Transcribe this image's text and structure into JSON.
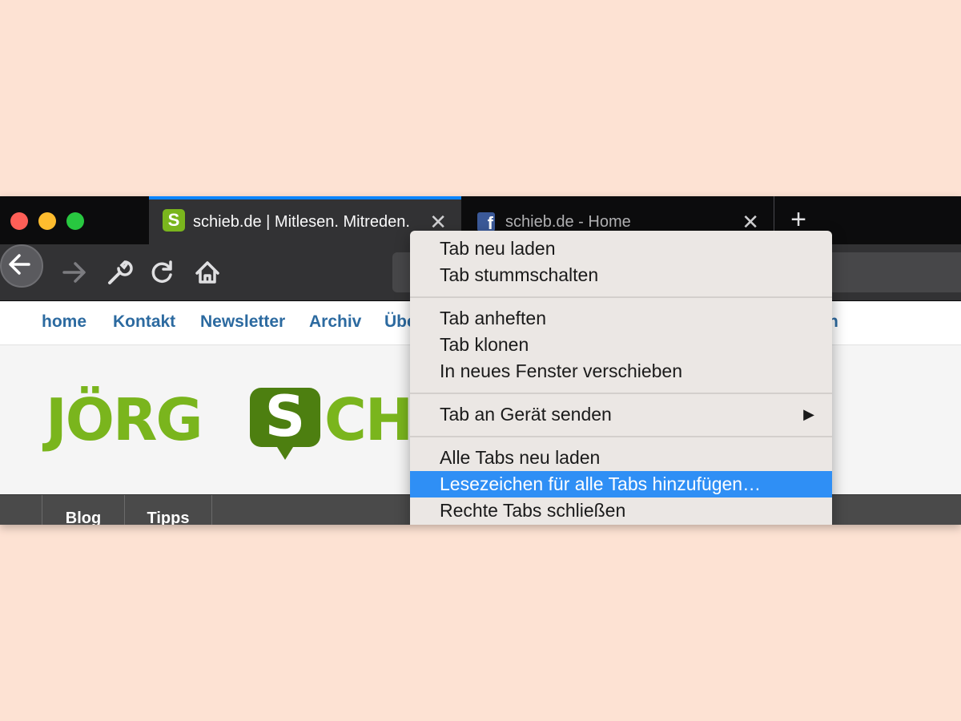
{
  "window": {
    "traffic_lights": {
      "close": "#fe5f57",
      "minimize": "#febc2e",
      "maximize": "#28c840"
    }
  },
  "tabs": [
    {
      "title": "schieb.de | Mitlesen. Mitreden.",
      "favicon_letter": "S",
      "active": true,
      "close": "✕"
    },
    {
      "title": "schieb.de - Home",
      "favicon_letter": "f",
      "active": false,
      "close": "✕"
    }
  ],
  "new_tab": "+",
  "accent": "#0a84ff",
  "site": {
    "nav": [
      "home",
      "Kontakt",
      "Newsletter",
      "Archiv",
      "Übe",
      "n"
    ],
    "logo": {
      "part1": "JÖRG",
      "s": "S",
      "part2": "CH"
    },
    "menu": [
      "Blog",
      "Tipps"
    ],
    "brand_color": "#7ab51d"
  },
  "context_menu": {
    "items": [
      {
        "label": "Tab neu laden"
      },
      {
        "label": "Tab stummschalten"
      },
      {
        "label": "Tab anheften"
      },
      {
        "label": "Tab klonen"
      },
      {
        "label": "In neues Fenster verschieben"
      },
      {
        "label": "Tab an Gerät senden",
        "submenu": "▶"
      },
      {
        "label": "Alle Tabs neu laden"
      },
      {
        "label": "Lesezeichen für alle Tabs hinzufügen…",
        "highlighted": true
      },
      {
        "label": "Rechte Tabs schließen"
      }
    ],
    "highlight_color": "#2f8ff5"
  }
}
